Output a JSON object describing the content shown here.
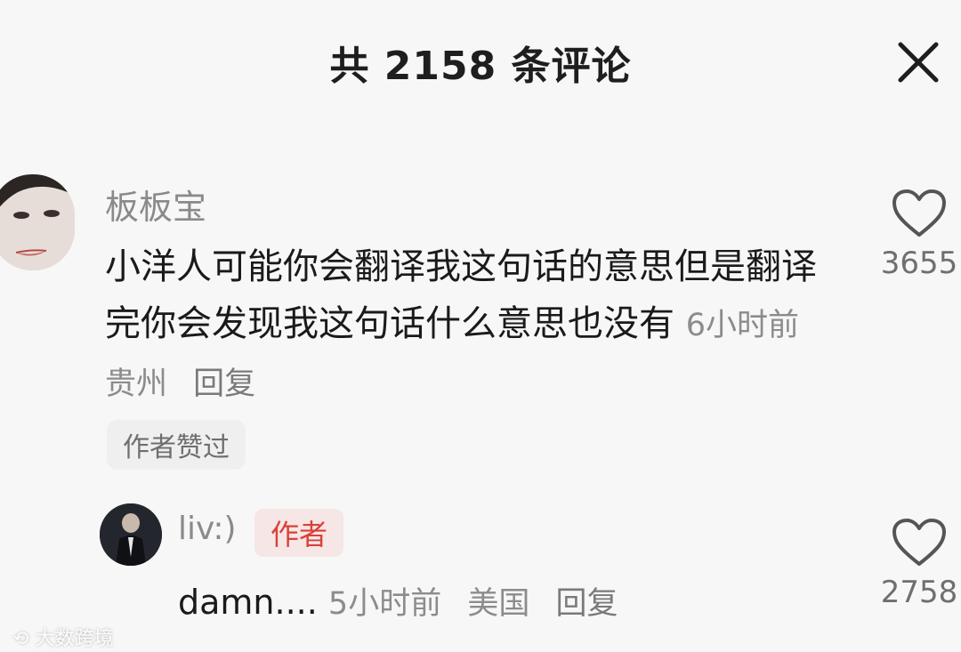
{
  "header": {
    "title": "共 2158 条评论"
  },
  "comment": {
    "username": "板板宝",
    "text": "小洋人可能你会翻译我这句话的意思但是翻译完你会发现我这句话什么意思也没有",
    "time": "6小时前",
    "location": "贵州",
    "reply_label": "回复",
    "author_liked": "作者赞过",
    "likes": "3655"
  },
  "reply": {
    "username": "liv:)",
    "badge": "作者",
    "text": "damn....",
    "time": "5小时前",
    "location": "美国",
    "reply_label": "回复",
    "likes": "2758"
  },
  "watermark": {
    "text": "大数跨境"
  },
  "colors": {
    "author_badge_text": "#d8413b",
    "author_badge_bg": "#f6e6e5",
    "muted_text": "#8a8a8a",
    "background": "#f7f7f7"
  }
}
